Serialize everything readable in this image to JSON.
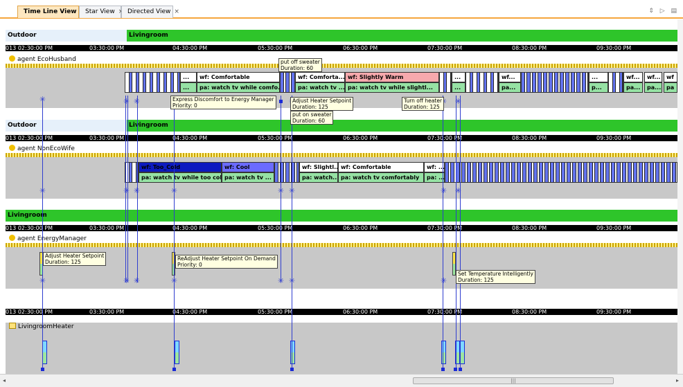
{
  "tabs": [
    {
      "label": "Time Line View",
      "close": "×"
    },
    {
      "label": "Star View",
      "close": "×"
    },
    {
      "label": "Directed View",
      "close": "×"
    }
  ],
  "tab_controls": "⇕ ▷ ▤",
  "time_ticks": [
    "013 02:30:00 PM",
    "03:30:00 PM",
    "04:30:00 PM",
    "05:30:00 PM",
    "06:30:00 PM",
    "07:30:00 PM",
    "08:30:00 PM",
    "09:30:00 PM"
  ],
  "locations": {
    "outdoor": "Outdoor",
    "livingroom": "Livingroom"
  },
  "agents": {
    "husband": "agent EcoHusband",
    "wife": "agent NonEcoWife",
    "manager": "agent EnergyManager",
    "heater": "LivingroomHeater"
  },
  "husband_cells": {
    "dots1": "...",
    "wf1": "wf: Comfortable",
    "wf2": "wf: Comforta...",
    "wf3": "wf: Slightly Warm",
    "dots2": "...",
    "wf4": "wf...",
    "dots3": "...",
    "wf5": "wf...",
    "wf6": "wf...",
    "wf7": "wf",
    "pdots1": "...",
    "pa1": "pa: watch tv while comfo...",
    "pa2": "pa: watch tv ...",
    "pa3": "pa: watch tv while slightl...",
    "pdots2": "...",
    "pa4": "pa...",
    "pa5": "p...",
    "pa6": "pa...",
    "pa7": "pa...",
    "pa8": "pa"
  },
  "wife_cells": {
    "wf1": "wf: Too_Cold",
    "wf2": "wf: Cool",
    "wf3": "wf: Slightl...",
    "wf4": "wf: Comfortable",
    "wf5": "wf: ...",
    "pa1": "pa: watch tv while too cold",
    "pa2": "pa: watch tv ...",
    "pa3": "pa: watch...",
    "pa4": "pa: watch tv comfortably",
    "pa5": "pa: ..."
  },
  "tooltips": {
    "put_off": {
      "title": "put off sweater",
      "detail": "Duration: 60"
    },
    "express": {
      "title": "Express Discomfort to Energy Manager",
      "detail": "Priority: 0"
    },
    "adjust1": {
      "title": "Adjust Heater Setpoint",
      "detail": "Duration: 125"
    },
    "put_on": {
      "title": "put on sweater",
      "detail": "Duration: 60"
    },
    "turn_off": {
      "title": "Turn off heater",
      "detail": "Duration: 125"
    },
    "adjust2": {
      "title": "Adjust Heater Setpoint",
      "detail": "Duration: 125"
    },
    "readjust": {
      "title": "ReAdjust Heater Setpoint On Demand",
      "detail": "Priority: 0"
    },
    "settemp": {
      "title": "Set Temperature Intelligently",
      "detail": "Duration: 125"
    }
  },
  "scrollbar": {
    "left": "◂",
    "right": "▸",
    "grip": "|||"
  },
  "colors": {
    "tab_accent": "#f5a53c",
    "livingroom": "#2ec52a",
    "outdoor": "#e6f0fa",
    "link_blue": "#2e3ccf",
    "pa_green": "#96e2a4",
    "too_cold_blue": "#0d1ac0",
    "slightly_warm_pink": "#f7a9ad"
  }
}
